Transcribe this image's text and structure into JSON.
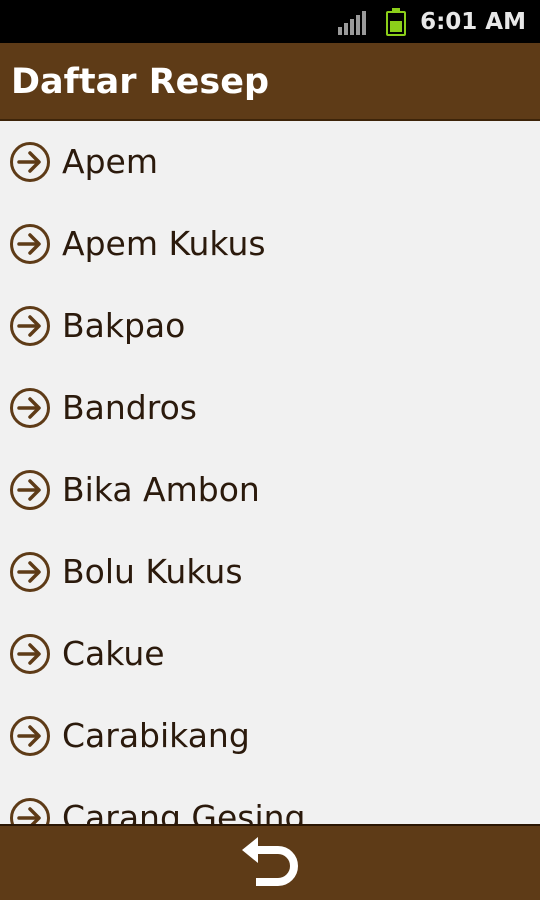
{
  "status_bar": {
    "time": "6:01 AM",
    "signal_icon": "signal-bars-icon",
    "battery_icon": "battery-charging-icon",
    "battery_level": 0.5
  },
  "header": {
    "title": "Daftar Resep"
  },
  "recipes": [
    {
      "label": "Apem",
      "icon": "arrow-right-circle-icon"
    },
    {
      "label": "Apem Kukus",
      "icon": "arrow-right-circle-icon"
    },
    {
      "label": "Bakpao",
      "icon": "arrow-right-circle-icon"
    },
    {
      "label": "Bandros",
      "icon": "arrow-right-circle-icon"
    },
    {
      "label": "Bika Ambon",
      "icon": "arrow-right-circle-icon"
    },
    {
      "label": "Bolu Kukus",
      "icon": "arrow-right-circle-icon"
    },
    {
      "label": "Cakue",
      "icon": "arrow-right-circle-icon"
    },
    {
      "label": "Carabikang",
      "icon": "arrow-right-circle-icon"
    },
    {
      "label": "Carang Gesing",
      "icon": "arrow-right-circle-icon"
    }
  ],
  "bottom_bar": {
    "back_icon": "back-arrow-icon"
  },
  "colors": {
    "primary_brown": "#5e3b17",
    "list_background": "#f1f1f1",
    "text_dark": "#2b1a0c",
    "icon_brown": "#5e3b17"
  }
}
